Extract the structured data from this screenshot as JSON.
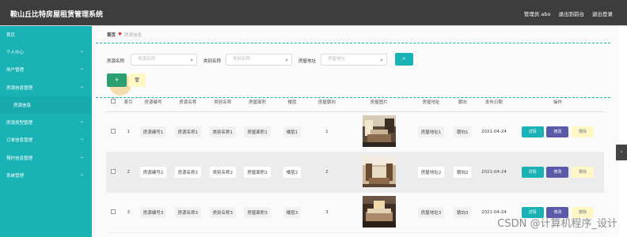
{
  "app": {
    "title": "鞍山丘比特房屋租赁管理系统",
    "admin_label": "管理员 abo",
    "back_link": "退出到前台",
    "logout_link": "退出登录"
  },
  "sidebar": {
    "items": [
      {
        "label": "首页",
        "has_chevron": false
      },
      {
        "label": "个人中心",
        "has_chevron": true
      },
      {
        "label": "用户管理",
        "has_chevron": true
      },
      {
        "label": "房源信息管理",
        "has_chevron": true
      },
      {
        "label": "房源信息",
        "has_chevron": false
      },
      {
        "label": "房源类型管理",
        "has_chevron": true
      },
      {
        "label": "订单信息管理",
        "has_chevron": true
      },
      {
        "label": "预约信息管理",
        "has_chevron": true
      },
      {
        "label": "系统管理",
        "has_chevron": true
      }
    ],
    "chevron": "⌄"
  },
  "breadcrumb": {
    "home": "首页",
    "separator": "♥",
    "current": "房源信息"
  },
  "search": {
    "name_label": "房源名称",
    "name_placeholder": "房源名称",
    "type_label": "类别名称",
    "type_placeholder": "类别名称",
    "addr_label": "房屋地址",
    "addr_placeholder": "房屋地址",
    "search_icon": "⌕"
  },
  "actions": {
    "add_icon": "+",
    "delete_icon": "🗑"
  },
  "table": {
    "headers": [
      "索引",
      "房源编号",
      "房源名称",
      "类别名称",
      "房屋面积",
      "楼层",
      "房屋朝向",
      "房屋图片",
      "房屋地址",
      "朝向",
      "发布日期",
      "操作"
    ],
    "rows": [
      {
        "index": "1",
        "code": "房源编号1",
        "name": "房源名称1",
        "type": "类别名称1",
        "area": "房屋面积1",
        "floor": "楼层1",
        "orient_num": "1",
        "addr": "房屋地址1",
        "orient": "朝向1",
        "date": "2021-04-24"
      },
      {
        "index": "2",
        "code": "房源编号2",
        "name": "房源名称2",
        "type": "类别名称2",
        "area": "房屋面积2",
        "floor": "楼层2",
        "orient_num": "2",
        "addr": "房屋地址2",
        "orient": "朝向2",
        "date": "2021-04-24"
      },
      {
        "index": "3",
        "code": "房源编号3",
        "name": "房源名称3",
        "type": "类别名称3",
        "area": "房屋面积3",
        "floor": "楼层3",
        "orient_num": "3",
        "addr": "房屋地址3",
        "orient": "朝向3",
        "date": "2021-04-24"
      }
    ],
    "op_detail": "详情",
    "op_edit": "修改",
    "op_delete": "删除"
  },
  "watermark": "CSDN @计算机程序_设计",
  "colors": {
    "topbar": "#3d3d3d",
    "sidebar": "#19b2b5",
    "accent": "#19b2b5",
    "edit": "#5b5aa9",
    "delete": "#fff7c6",
    "add": "#2c9f73"
  }
}
